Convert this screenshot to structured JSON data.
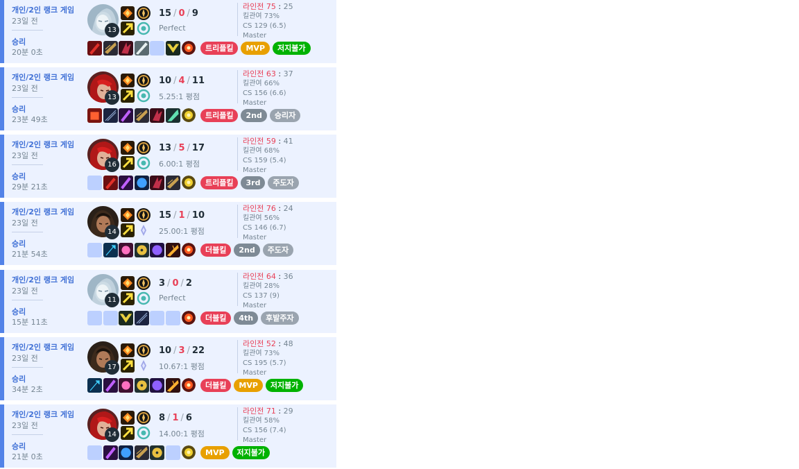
{
  "colors": {
    "panel_bg": "#ecf2ff",
    "win_bar": "#5383e8",
    "win_text": "#4171d6",
    "muted": "#758592",
    "death": "#e84057",
    "badge_kill": "#e84057",
    "badge_mvp": "#e8a000",
    "badge_green": "#00b200",
    "badge_gray": "#7e8a95",
    "badge_lightgray": "#9aa4af"
  },
  "matches": [
    {
      "queue": "개인/2인 랭크 게임",
      "ago": "23일 전",
      "result": "승리",
      "duration": "20분 0초",
      "champion_icon": "champion-portrait-icon-pale",
      "level": "13",
      "kills": "15",
      "deaths": "0",
      "assists": "9",
      "ratio": "Perfect",
      "lane_label": "라인전",
      "lane_win": "75",
      "lane_colon": ":",
      "lane_lose": "25",
      "kill_participation": "킬관여 73%",
      "cs": "CS 129 (6.5)",
      "tier": "Master",
      "items": [
        "item-red-sword-icon",
        "item-dark-blade-icon",
        "item-red-claw-icon",
        "item-silver-blade-icon",
        "empty",
        "item-gold-chevron-icon"
      ],
      "ward": "ward-red-icon",
      "badges": [
        {
          "label": "트리플킬",
          "color": "#e84057"
        },
        {
          "label": "MVP",
          "color": "#e8a000"
        },
        {
          "label": "저지불가",
          "color": "#00b200"
        }
      ],
      "rune_secondary": "rune-teal-icon"
    },
    {
      "queue": "개인/2인 랭크 게임",
      "ago": "23일 전",
      "result": "승리",
      "duration": "23분 49초",
      "champion_icon": "champion-portrait-icon-red",
      "level": "13",
      "kills": "10",
      "deaths": "4",
      "assists": "11",
      "ratio": "5.25:1 평점",
      "lane_label": "라인전",
      "lane_win": "63",
      "lane_colon": ":",
      "lane_lose": "37",
      "kill_participation": "킬관여 66%",
      "cs": "CS 156 (6.6)",
      "tier": "Master",
      "items": [
        "item-red-fist-icon",
        "item-dark-lance-icon",
        "item-purple-blade-icon",
        "item-dark-blade-icon",
        "item-red-claw-icon",
        "item-green-axe-icon"
      ],
      "ward": "ward-gold-icon",
      "badges": [
        {
          "label": "트리플킬",
          "color": "#e84057"
        },
        {
          "label": "2nd",
          "color": "#7e8a95"
        },
        {
          "label": "승리자",
          "color": "#9aa4af"
        }
      ],
      "rune_secondary": "rune-teal-icon"
    },
    {
      "queue": "개인/2인 랭크 게임",
      "ago": "23일 전",
      "result": "승리",
      "duration": "29분 21초",
      "champion_icon": "champion-portrait-icon-red",
      "level": "16",
      "kills": "13",
      "deaths": "5",
      "assists": "17",
      "ratio": "6.00:1 평점",
      "lane_label": "라인전",
      "lane_win": "59",
      "lane_colon": ":",
      "lane_lose": "41",
      "kill_participation": "킬관여 68%",
      "cs": "CS 159 (5.4)",
      "tier": "Master",
      "items": [
        "empty",
        "item-red-sword-icon",
        "item-purple-blade-icon",
        "item-blue-orb-icon",
        "item-red-claw-icon",
        "item-dark-blade-icon"
      ],
      "ward": "ward-gold-icon",
      "badges": [
        {
          "label": "트리플킬",
          "color": "#e84057"
        },
        {
          "label": "3rd",
          "color": "#7e8a95"
        },
        {
          "label": "주도자",
          "color": "#9aa4af"
        }
      ],
      "rune_secondary": "rune-teal-icon"
    },
    {
      "queue": "개인/2인 랭크 게임",
      "ago": "23일 전",
      "result": "승리",
      "duration": "21분 54초",
      "champion_icon": "champion-portrait-icon-dark",
      "level": "14",
      "kills": "15",
      "deaths": "1",
      "assists": "10",
      "ratio": "25.00:1 평점",
      "lane_label": "라인전",
      "lane_win": "76",
      "lane_colon": ":",
      "lane_lose": "24",
      "kill_participation": "킬관여 56%",
      "cs": "CS 146 (6.7)",
      "tier": "Master",
      "items": [
        "empty",
        "item-blue-staff-icon",
        "item-pink-orb-icon",
        "item-gold-orb-icon",
        "item-purple-orb-icon",
        "item-fire-blade-icon"
      ],
      "ward": "ward-red-icon",
      "badges": [
        {
          "label": "더블킬",
          "color": "#e84057"
        },
        {
          "label": "2nd",
          "color": "#7e8a95"
        },
        {
          "label": "주도자",
          "color": "#9aa4af"
        }
      ],
      "rune_secondary": "rune-violet-icon"
    },
    {
      "queue": "개인/2인 랭크 게임",
      "ago": "23일 전",
      "result": "승리",
      "duration": "15분 11초",
      "champion_icon": "champion-portrait-icon-pale",
      "level": "11",
      "kills": "3",
      "deaths": "0",
      "assists": "2",
      "ratio": "Perfect",
      "lane_label": "라인전",
      "lane_win": "64",
      "lane_colon": ":",
      "lane_lose": "36",
      "kill_participation": "킬관여 28%",
      "cs": "CS 137 (9)",
      "tier": "Master",
      "items": [
        "empty",
        "empty",
        "item-gold-chevron-icon",
        "item-dark-lance-icon",
        "empty",
        "empty"
      ],
      "ward": "ward-red-icon",
      "badges": [
        {
          "label": "더블킬",
          "color": "#e84057"
        },
        {
          "label": "4th",
          "color": "#7e8a95"
        },
        {
          "label": "후발주자",
          "color": "#9aa4af"
        }
      ],
      "rune_secondary": "rune-teal-icon"
    },
    {
      "queue": "개인/2인 랭크 게임",
      "ago": "23일 전",
      "result": "승리",
      "duration": "34분 2초",
      "champion_icon": "champion-portrait-icon-dark",
      "level": "17",
      "kills": "10",
      "deaths": "3",
      "assists": "22",
      "ratio": "10.67:1 평점",
      "lane_label": "라인전",
      "lane_win": "52",
      "lane_colon": ":",
      "lane_lose": "48",
      "kill_participation": "킬관여 73%",
      "cs": "CS 195 (5.7)",
      "tier": "Master",
      "items": [
        "item-blue-staff-icon",
        "item-purple-blade-icon",
        "item-pink-orb-icon",
        "item-gold-orb-icon",
        "item-purple-orb-icon",
        "item-fire-blade-icon"
      ],
      "ward": "ward-red-icon",
      "badges": [
        {
          "label": "더블킬",
          "color": "#e84057"
        },
        {
          "label": "MVP",
          "color": "#e8a000"
        },
        {
          "label": "저지불가",
          "color": "#00b200"
        }
      ],
      "rune_secondary": "rune-violet-icon"
    },
    {
      "queue": "개인/2인 랭크 게임",
      "ago": "23일 전",
      "result": "승리",
      "duration": "21분 0초",
      "champion_icon": "champion-portrait-icon-red",
      "level": "14",
      "kills": "8",
      "deaths": "1",
      "assists": "6",
      "ratio": "14.00:1 평점",
      "lane_label": "라인전",
      "lane_win": "71",
      "lane_colon": ":",
      "lane_lose": "29",
      "kill_participation": "킬관여 58%",
      "cs": "CS 156 (7.4)",
      "tier": "Master",
      "items": [
        "empty",
        "item-purple-blade-icon",
        "item-blue-orb-icon",
        "item-dark-blade-icon",
        "item-gold-orb-icon",
        "empty"
      ],
      "ward": "ward-gold-icon",
      "badges": [
        {
          "label": "MVP",
          "color": "#e8a000"
        },
        {
          "label": "저지불가",
          "color": "#00b200"
        }
      ],
      "rune_secondary": "rune-teal-icon"
    }
  ]
}
